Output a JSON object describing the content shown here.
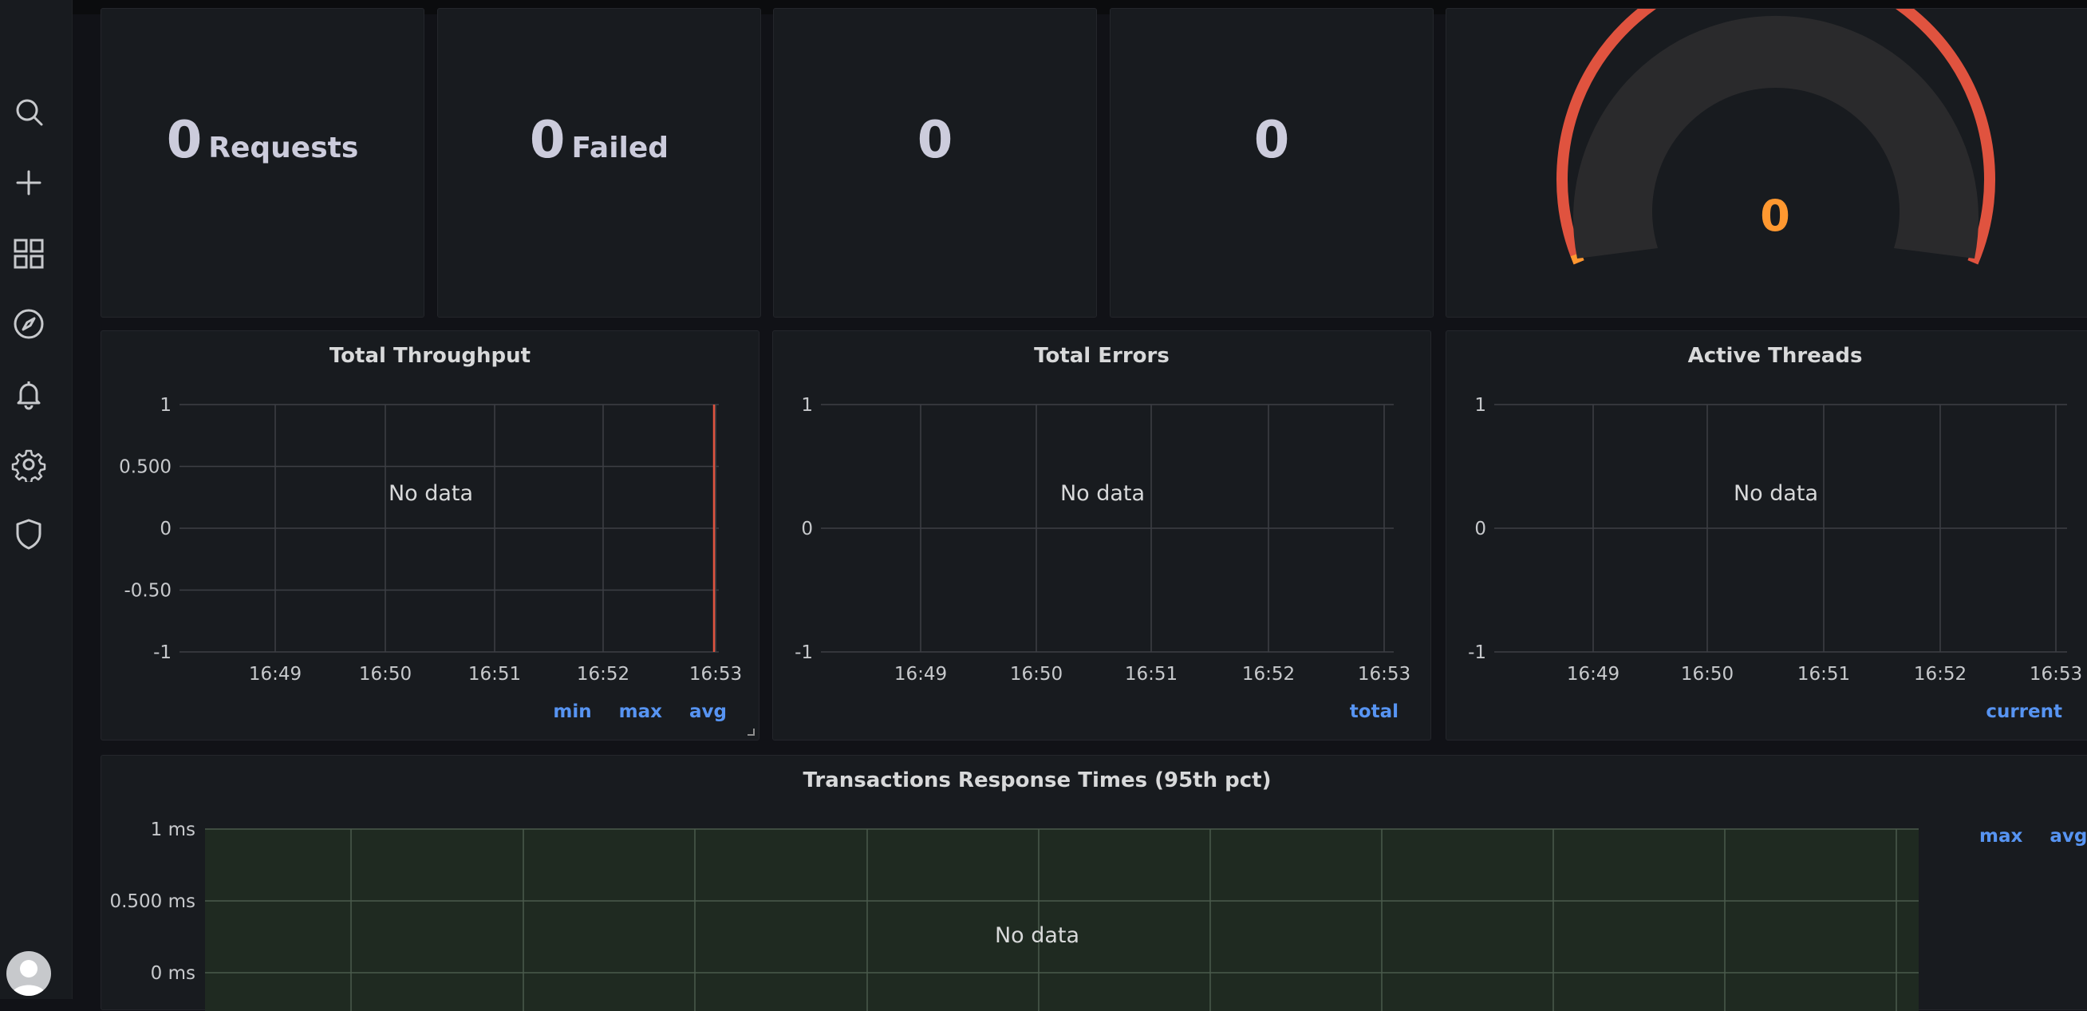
{
  "sidebar": {
    "items": [
      {
        "name": "search-icon"
      },
      {
        "name": "plus-icon"
      },
      {
        "name": "dashboards-icon"
      },
      {
        "name": "explore-compass-icon"
      },
      {
        "name": "alerting-bell-icon"
      },
      {
        "name": "configuration-gear-icon"
      },
      {
        "name": "server-admin-shield-icon"
      }
    ],
    "avatar_icon": "user-avatar-icon"
  },
  "stats": [
    {
      "value": "0",
      "unit": "Requests"
    },
    {
      "value": "0",
      "unit": "Failed"
    },
    {
      "value": "0",
      "unit": ""
    },
    {
      "value": "0",
      "unit": ""
    }
  ],
  "gauge": {
    "value": "0",
    "value_color": "#ff9830",
    "arc_color": "#e0533f"
  },
  "colors": {
    "accent": "#5794f2",
    "panel_bg": "#181b1f",
    "page_bg": "#111217",
    "threshold_line": "#e0533f"
  },
  "charts": [
    {
      "title": "Total Throughput",
      "no_data": "No data",
      "legend": [
        "min",
        "max",
        "avg"
      ],
      "chart_data": {
        "type": "line",
        "x": [
          "16:49",
          "16:50",
          "16:51",
          "16:52",
          "16:53"
        ],
        "y_ticks": [
          "1",
          "0.500",
          "0",
          "-0.50",
          "-1"
        ],
        "ylim": [
          -1,
          1
        ],
        "series": [],
        "grid": true
      }
    },
    {
      "title": "Total Errors",
      "no_data": "No data",
      "legend": [
        "total"
      ],
      "chart_data": {
        "type": "line",
        "x": [
          "16:49",
          "16:50",
          "16:51",
          "16:52",
          "16:53"
        ],
        "y_ticks": [
          "1",
          "0",
          "-1"
        ],
        "ylim": [
          -1,
          1
        ],
        "series": [],
        "grid": true
      }
    },
    {
      "title": "Active Threads",
      "no_data": "No data",
      "legend": [
        "current"
      ],
      "chart_data": {
        "type": "line",
        "x": [
          "16:49",
          "16:50",
          "16:51",
          "16:52",
          "16:53"
        ],
        "y_ticks": [
          "1",
          "0",
          "-1"
        ],
        "ylim": [
          -1,
          1
        ],
        "series": [],
        "grid": true
      }
    }
  ],
  "response_times": {
    "title": "Transactions Response Times (95th pct)",
    "no_data": "No data",
    "legend": [
      "max",
      "avg"
    ],
    "chart_data": {
      "type": "line",
      "y_ticks": [
        "1 ms",
        "0.500 ms",
        "0 ms"
      ],
      "series": [],
      "grid": true,
      "background": "#1f2a21"
    }
  }
}
